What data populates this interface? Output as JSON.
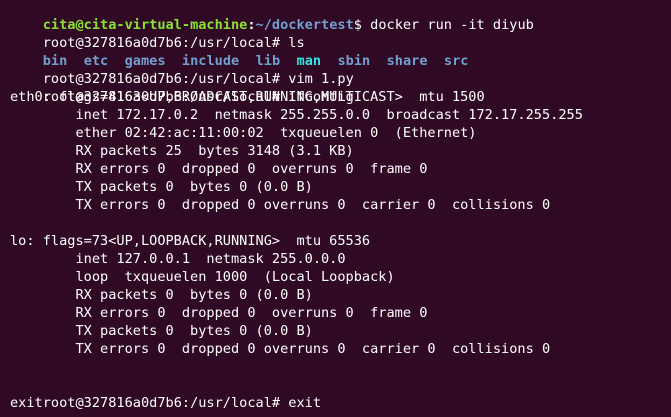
{
  "colors": {
    "background": "#300a24",
    "text": "#ffffff",
    "prompt_user": "#8ae234",
    "prompt_path": "#729fcf",
    "dir_listing": "#729fcf",
    "dir_highlight": "#34e2e2"
  },
  "host_prompt": {
    "user_host": "cita@cita-virtual-machine",
    "colon": ":",
    "path": "~/dockertest",
    "symbol": "$",
    "command": " docker run -it diyub"
  },
  "container_prompt": "root@327816a0d7b6:/usr/local#",
  "commands": {
    "ls": " ls",
    "vim": " vim 1.py",
    "ifconfig": " ifconfig",
    "exit": " exit"
  },
  "ls_items": [
    "bin",
    "etc",
    "games",
    "include",
    "lib",
    "man",
    "sbin",
    "share",
    "src"
  ],
  "eth0": [
    "eth0: flags=4163<UP,BROADCAST,RUNNING,MULTICAST>  mtu 1500",
    "        inet 172.17.0.2  netmask 255.255.0.0  broadcast 172.17.255.255",
    "        ether 02:42:ac:11:00:02  txqueuelen 0  (Ethernet)",
    "        RX packets 25  bytes 3148 (3.1 KB)",
    "        RX errors 0  dropped 0  overruns 0  frame 0",
    "        TX packets 0  bytes 0 (0.0 B)",
    "        TX errors 0  dropped 0 overruns 0  carrier 0  collisions 0"
  ],
  "lo": [
    "lo: flags=73<UP,LOOPBACK,RUNNING>  mtu 65536",
    "        inet 127.0.0.1  netmask 255.0.0.0",
    "        loop  txqueuelen 1000  (Local Loopback)",
    "        RX packets 0  bytes 0 (0.0 B)",
    "        RX errors 0  dropped 0  overruns 0  frame 0",
    "        TX packets 0  bytes 0 (0.0 B)",
    "        TX errors 0  dropped 0 overruns 0  carrier 0  collisions 0"
  ],
  "exit_output": "exit"
}
